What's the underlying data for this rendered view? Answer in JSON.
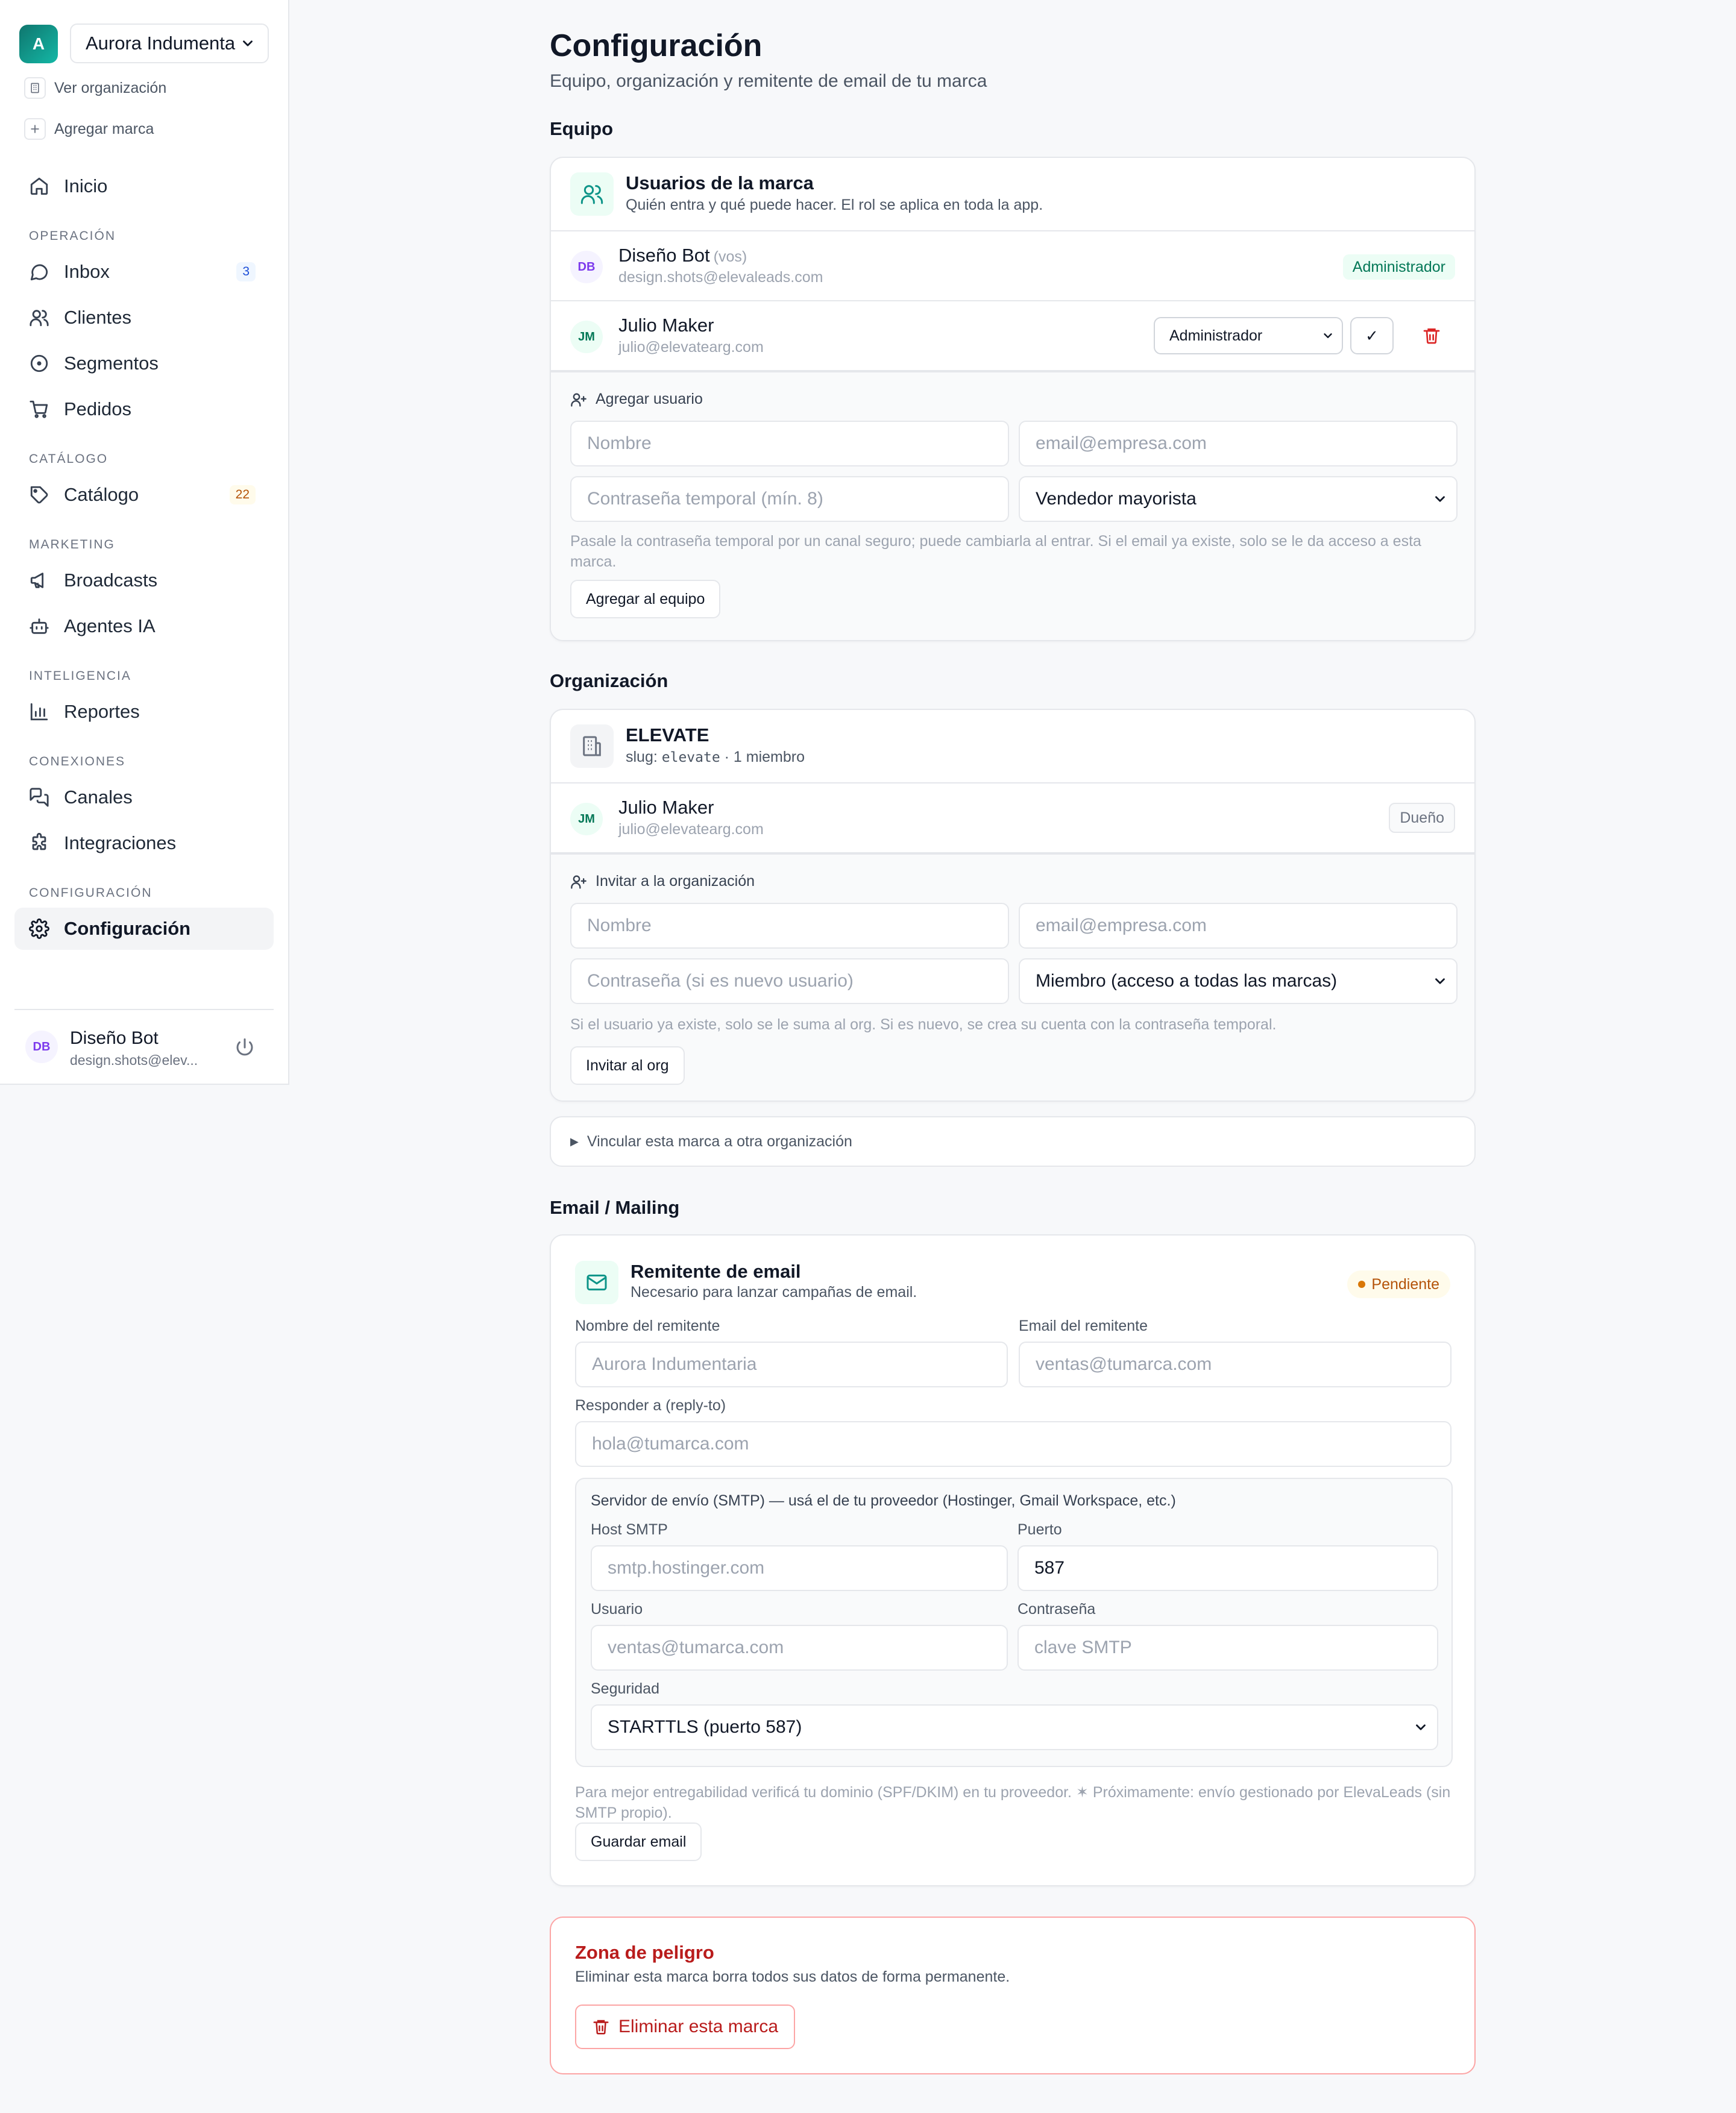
{
  "sidebar": {
    "brand_initial": "A",
    "brand_name": "Aurora Indumentaria",
    "view_org": "Ver organización",
    "add_brand": "Agregar marca",
    "home": "Inicio",
    "sections": {
      "operacion": "OPERACIÓN",
      "catalogo": "CATÁLOGO",
      "marketing": "MARKETING",
      "inteligencia": "INTELIGENCIA",
      "conexiones": "CONEXIONES",
      "configuracion": "CONFIGURACIÓN"
    },
    "items": {
      "inbox": "Inbox",
      "inbox_badge": "3",
      "clientes": "Clientes",
      "segmentos": "Segmentos",
      "pedidos": "Pedidos",
      "catalogo": "Catálogo",
      "catalogo_badge": "22",
      "broadcasts": "Broadcasts",
      "agentes": "Agentes IA",
      "reportes": "Reportes",
      "canales": "Canales",
      "integraciones": "Integraciones",
      "configuracion": "Configuración"
    },
    "user": {
      "initials": "DB",
      "name": "Diseño Bot",
      "email": "design.shots@elev..."
    }
  },
  "page": {
    "title": "Configuración",
    "subtitle": "Equipo, organización y remitente de email de tu marca"
  },
  "team": {
    "section_title": "Equipo",
    "card_title": "Usuarios de la marca",
    "card_sub": "Quién entra y qué puede hacer. El rol se aplica en toda la app.",
    "members": [
      {
        "initials": "DB",
        "name": "Diseño Bot",
        "you": "(vos)",
        "email": "design.shots@elevaleads.com",
        "role": "Administrador"
      },
      {
        "initials": "JM",
        "name": "Julio Maker",
        "email": "julio@elevatearg.com",
        "role": "Administrador",
        "save": "✓"
      }
    ],
    "add_label": "Agregar usuario",
    "name_placeholder": "Nombre",
    "email_placeholder": "email@empresa.com",
    "password_placeholder": "Contraseña temporal (mín. 8)",
    "role_select": "Vendedor mayorista",
    "help": "Pasale la contraseña temporal por un canal seguro; puede cambiarla al entrar. Si el email ya existe, solo se le da acceso a esta marca.",
    "add_button": "Agregar al equipo"
  },
  "org": {
    "section_title": "Organización",
    "card_title": "ELEVATE",
    "slug_prefix": "slug:",
    "slug": "elevate",
    "members_count": "· 1 miembro",
    "member": {
      "initials": "JM",
      "name": "Julio Maker",
      "email": "julio@elevatearg.com",
      "role": "Dueño"
    },
    "invite_label": "Invitar a la organización",
    "name_placeholder": "Nombre",
    "email_placeholder": "email@empresa.com",
    "password_placeholder": "Contraseña (si es nuevo usuario)",
    "role_select": "Miembro (acceso a todas las marcas)",
    "help": "Si el usuario ya existe, solo se le suma al org. Si es nuevo, se crea su cuenta con la contraseña temporal.",
    "invite_button": "Invitar al org",
    "link_toggle": "Vincular esta marca a otra organización"
  },
  "email": {
    "section_title": "Email / Mailing",
    "card_title": "Remitente de email",
    "card_sub": "Necesario para lanzar campañas de email.",
    "status": "Pendiente",
    "sender_name_label": "Nombre del remitente",
    "sender_name_placeholder": "Aurora Indumentaria",
    "sender_email_label": "Email del remitente",
    "sender_email_placeholder": "ventas@tumarca.com",
    "reply_label": "Responder a (reply-to)",
    "reply_placeholder": "hola@tumarca.com",
    "smtp_title": "Servidor de envío (SMTP) — usá el de tu proveedor (Hostinger, Gmail Workspace, etc.)",
    "host_label": "Host SMTP",
    "host_placeholder": "smtp.hostinger.com",
    "port_label": "Puerto",
    "port_value": "587",
    "user_label": "Usuario",
    "user_placeholder": "ventas@tumarca.com",
    "pass_label": "Contraseña",
    "pass_placeholder": "clave SMTP",
    "security_label": "Seguridad",
    "security_value": "STARTTLS (puerto 587)",
    "help": "Para mejor entregabilidad verificá tu dominio (SPF/DKIM) en tu proveedor. ✶ Próximamente: envío gestionado por ElevaLeads (sin SMTP propio).",
    "save_button": "Guardar email"
  },
  "danger": {
    "title": "Zona de peligro",
    "sub": "Eliminar esta marca borra todos sus datos de forma permanente.",
    "button": "Eliminar esta marca"
  }
}
